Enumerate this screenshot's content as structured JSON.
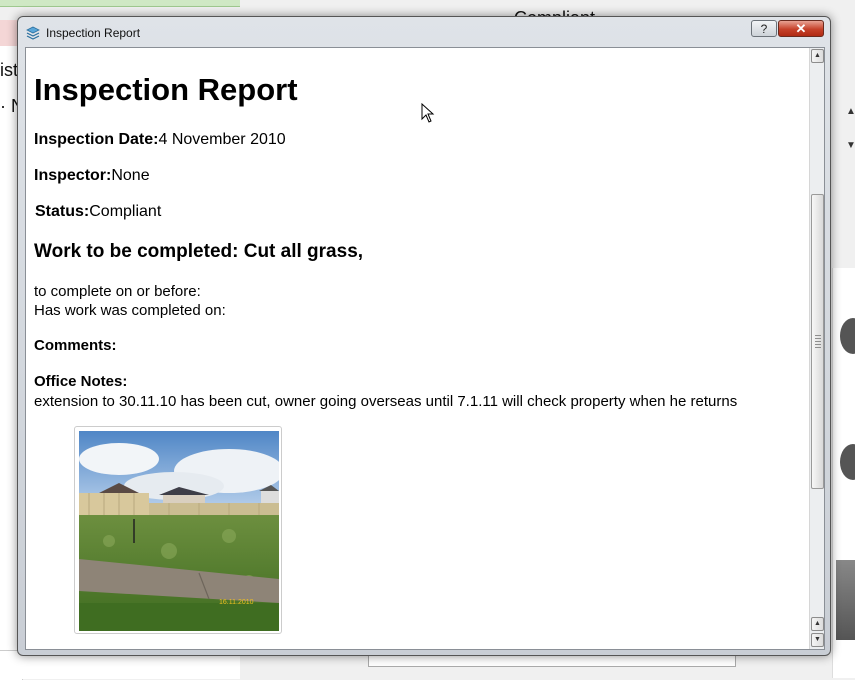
{
  "window": {
    "title": "Inspection Report",
    "help_label": "?",
    "close_label": "✕"
  },
  "background": {
    "header_fragment": "Compliant",
    "left_fragment_1": "ist",
    "left_fragment_2": "· N"
  },
  "report": {
    "title": "Inspection Report",
    "inspection_date_label": "Inspection Date:",
    "inspection_date_value": "4 November 2010",
    "inspector_label": "Inspector:",
    "inspector_value": "None",
    "status_label": "Status:",
    "status_value": "Compliant",
    "work_heading": "Work to be completed: Cut all grass,",
    "complete_before_label": "to complete on or before:",
    "completed_on_label": "Has work was completed on:",
    "comments_label": "Comments:",
    "office_notes_label": "Office Notes:",
    "office_notes_text": "extension to 30.11.10 has been cut, owner going overseas until 7.1.11 will check property when he returns",
    "photo_date_stamp": "16.11.2010"
  },
  "icons": {
    "window_icon": "layers-icon",
    "cursor": "mouse-pointer-icon"
  },
  "colors": {
    "close_button": "#c6412a",
    "window_frame": "#c9ced5",
    "sky": "#8fb4e0",
    "grass": "#4f7d2c"
  }
}
